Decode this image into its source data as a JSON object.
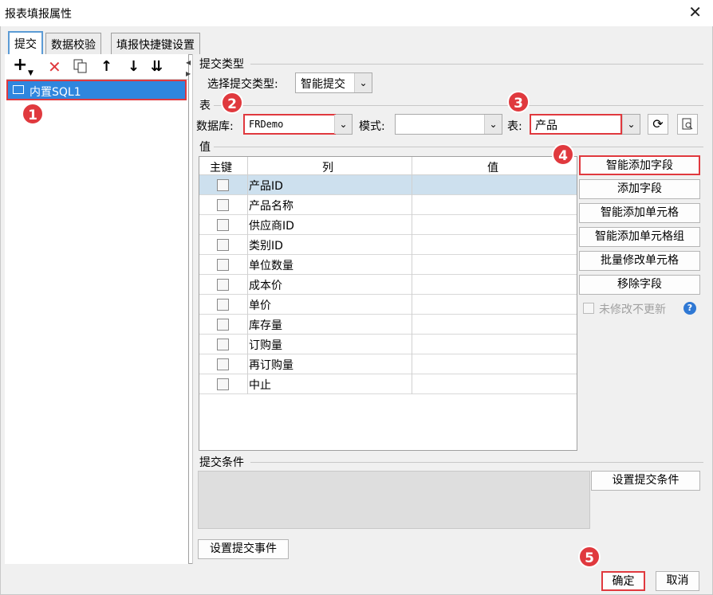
{
  "window": {
    "title": "报表填报属性",
    "close_glyph": "✕"
  },
  "tabs": [
    "提交",
    "数据校验",
    "填报快捷键设置"
  ],
  "left_panel": {
    "toolbar_icons": [
      "add-icon",
      "delete-icon",
      "copy-icon",
      "move-up-icon",
      "move-down-icon",
      "move-bottom-icon"
    ],
    "items": [
      {
        "label": "内置SQL1",
        "selected": true
      }
    ]
  },
  "submit_type": {
    "section_label": "提交类型",
    "field_label": "选择提交类型:",
    "value": "智能提交"
  },
  "table_section": {
    "section_label": "表",
    "database_label": "数据库:",
    "database_value": "FRDemo",
    "schema_label": "模式:",
    "schema_value": "",
    "table_label": "表:",
    "table_value": "产品"
  },
  "value_section": {
    "section_label": "值",
    "columns": [
      "主键",
      "列",
      "值"
    ],
    "rows": [
      {
        "column": "产品ID",
        "value": "",
        "primary": false,
        "selected": true
      },
      {
        "column": "产品名称",
        "value": "",
        "primary": false,
        "selected": false
      },
      {
        "column": "供应商ID",
        "value": "",
        "primary": false,
        "selected": false
      },
      {
        "column": "类别ID",
        "value": "",
        "primary": false,
        "selected": false
      },
      {
        "column": "单位数量",
        "value": "",
        "primary": false,
        "selected": false
      },
      {
        "column": "成本价",
        "value": "",
        "primary": false,
        "selected": false
      },
      {
        "column": "单价",
        "value": "",
        "primary": false,
        "selected": false
      },
      {
        "column": "库存量",
        "value": "",
        "primary": false,
        "selected": false
      },
      {
        "column": "订购量",
        "value": "",
        "primary": false,
        "selected": false
      },
      {
        "column": "再订购量",
        "value": "",
        "primary": false,
        "selected": false
      },
      {
        "column": "中止",
        "value": "",
        "primary": false,
        "selected": false
      }
    ]
  },
  "side_buttons": {
    "smart_add_field": "智能添加字段",
    "add_field": "添加字段",
    "smart_add_cell": "智能添加单元格",
    "smart_add_cell_group": "智能添加单元格组",
    "batch_modify_cell": "批量修改单元格",
    "remove_field": "移除字段",
    "no_update_unmodified": "未修改不更新",
    "no_update_checked": false
  },
  "condition_section": {
    "section_label": "提交条件",
    "set_condition_button": "设置提交条件"
  },
  "event_button": "设置提交事件",
  "footer": {
    "ok": "确定",
    "cancel": "取消"
  },
  "badges": [
    "1",
    "2",
    "3",
    "4",
    "5"
  ],
  "colors": {
    "accent": "#2f86de",
    "highlight": "#e0393e",
    "row_selected": "#cde0ee"
  }
}
